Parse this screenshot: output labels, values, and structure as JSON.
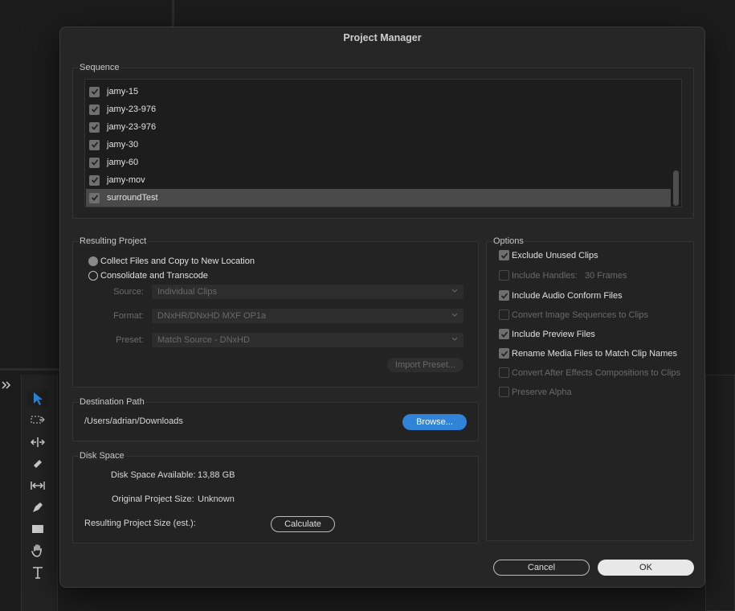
{
  "dialog": {
    "title": "Project Manager"
  },
  "sequence": {
    "label": "Sequence",
    "items": [
      {
        "name": "jamy-15",
        "checked": true,
        "selected": false
      },
      {
        "name": "jamy-23-976",
        "checked": true,
        "selected": false
      },
      {
        "name": "jamy-23-976",
        "checked": true,
        "selected": false
      },
      {
        "name": "jamy-30",
        "checked": true,
        "selected": false
      },
      {
        "name": "jamy-60",
        "checked": true,
        "selected": false
      },
      {
        "name": "jamy-mov",
        "checked": true,
        "selected": false
      },
      {
        "name": "surroundTest",
        "checked": true,
        "selected": true
      }
    ]
  },
  "resulting_project": {
    "label": "Resulting Project",
    "collect_label": "Collect Files and Copy to New Location",
    "consolidate_label": "Consolidate and Transcode",
    "selected_option": "collect",
    "source_label": "Source:",
    "source_value": "Individual Clips",
    "format_label": "Format:",
    "format_value": "DNxHR/DNxHD MXF OP1a",
    "preset_label": "Preset:",
    "preset_value": "Match Source - DNxHD",
    "import_preset_label": "Import Preset..."
  },
  "destination": {
    "label": "Destination Path",
    "path": "/Users/adrian/Downloads",
    "browse_label": "Browse..."
  },
  "disk_space": {
    "label": "Disk Space",
    "available_label": "Disk Space Available:",
    "available_value": "13,88 GB",
    "original_label": "Original Project Size:",
    "original_value": "Unknown",
    "resulting_label": "Resulting Project Size (est.):",
    "calculate_label": "Calculate"
  },
  "options": {
    "label": "Options",
    "exclude_unused": "Exclude Unused Clips",
    "include_handles": "Include Handles:",
    "handles_value": "30 Frames",
    "include_audio": "Include Audio Conform Files",
    "convert_image": "Convert Image Sequences to Clips",
    "include_preview": "Include Preview Files",
    "rename_media": "Rename Media Files to Match Clip Names",
    "convert_ae": "Convert After Effects Compositions to Clips",
    "preserve_alpha": "Preserve Alpha"
  },
  "footer": {
    "cancel_label": "Cancel",
    "ok_label": "OK"
  },
  "colors": {
    "accent": "#2f84d8",
    "dialog_bg": "#262626"
  }
}
